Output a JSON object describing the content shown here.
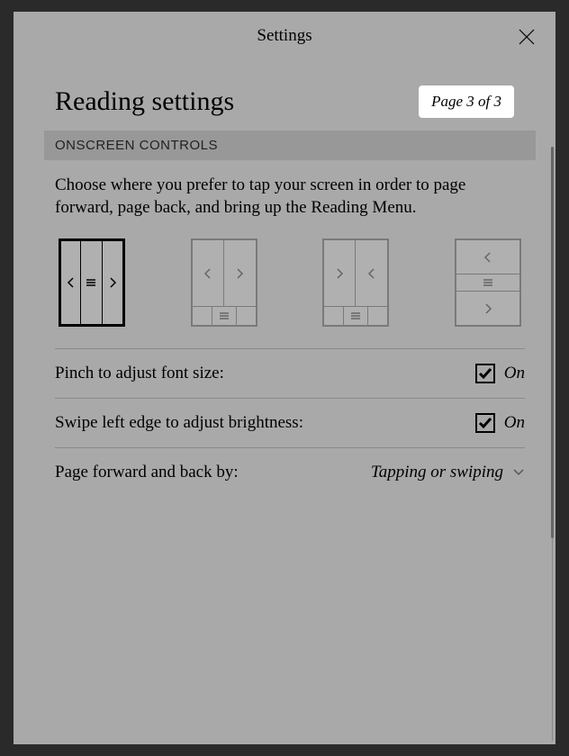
{
  "modal": {
    "title": "Settings"
  },
  "page": {
    "title": "Reading settings",
    "badge": "Page 3 of 3"
  },
  "section": {
    "label": "ONSCREEN CONTROLS",
    "description": "Choose where you prefer to tap your screen in order to page forward, page back, and bring up the Reading Menu."
  },
  "settings": {
    "pinch": {
      "label": "Pinch to adjust font size:",
      "state": "On"
    },
    "swipe": {
      "label": "Swipe left edge to adjust brightness:",
      "state": "On"
    },
    "paging": {
      "label": "Page forward and back by:",
      "value": "Tapping or swiping"
    }
  }
}
